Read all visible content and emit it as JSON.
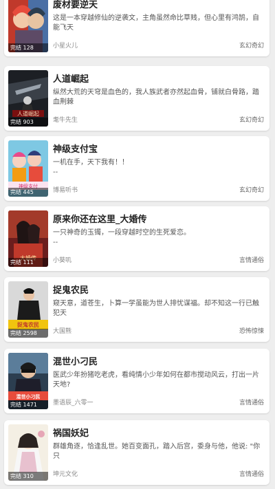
{
  "books": [
    {
      "title": "废材要逆天",
      "desc": "这是一本穿越修仙的逆袭文，主角虽然命比草贱，但心里有鸿鹄，自能飞天",
      "author": "小星火儿",
      "genre": "玄幻奇幻",
      "badge": "完结 128",
      "cover_art": "anime-youth-red-hair"
    },
    {
      "title": "人道崛起",
      "desc": "纵然大荒的天穹是血色的，我人族武者亦然起血骨，铺就白骨路，踏血荆棘",
      "author": "耄牛先生",
      "genre": "玄幻奇幻",
      "badge": "完结 903",
      "cover_art": "warrior-in-storm"
    },
    {
      "title": "神级支付宝",
      "desc": "一机在手，天下我有！！",
      "desc2": "--",
      "author": "博易听书",
      "genre": "玄幻奇幻",
      "badge": "完结 445",
      "cover_art": "anime-group-colorful"
    },
    {
      "title": "原来你还在这里_大婚传",
      "desc": "一只神奇的玉镯，一段穿越时空的生死爱恋。",
      "desc2": "--",
      "author": "小葵叽",
      "genre": "言情通俗",
      "badge": "完结 111",
      "cover_art": "ancient-couple-red"
    },
    {
      "title": "捉鬼农民",
      "desc": "窥天意，道苍生，卜算一学虽能为世人排忧谋福。却不知这一行已触犯天",
      "author": "大国熊",
      "genre": "恐怖惊悚",
      "badge": "完结 2598",
      "cover_art": "man-in-dark-suit"
    },
    {
      "title": "混世小刁民",
      "desc": "医武少年扮猪吃老虎，看纯情小少年如何在都市搅动风云，打出一片天地?",
      "author": "墨语辰_六零一",
      "genre": "言情通俗",
      "badge": "完结 1471",
      "cover_art": "man-with-sunglasses"
    },
    {
      "title": "祸国妖妃",
      "desc": "群雄角逐，恰逢乱世。她百变面孔，踏入后宫，委身与他，他说: \"你只",
      "author": "坤元文化",
      "genre": "言情通俗",
      "badge": "完结 310",
      "cover_art": "ancient-lady-white"
    }
  ],
  "colors": {
    "background": "#eeeeee",
    "card": "#ffffff",
    "title_text": "#222222",
    "desc_text": "#555555",
    "meta_text": "#888888"
  }
}
